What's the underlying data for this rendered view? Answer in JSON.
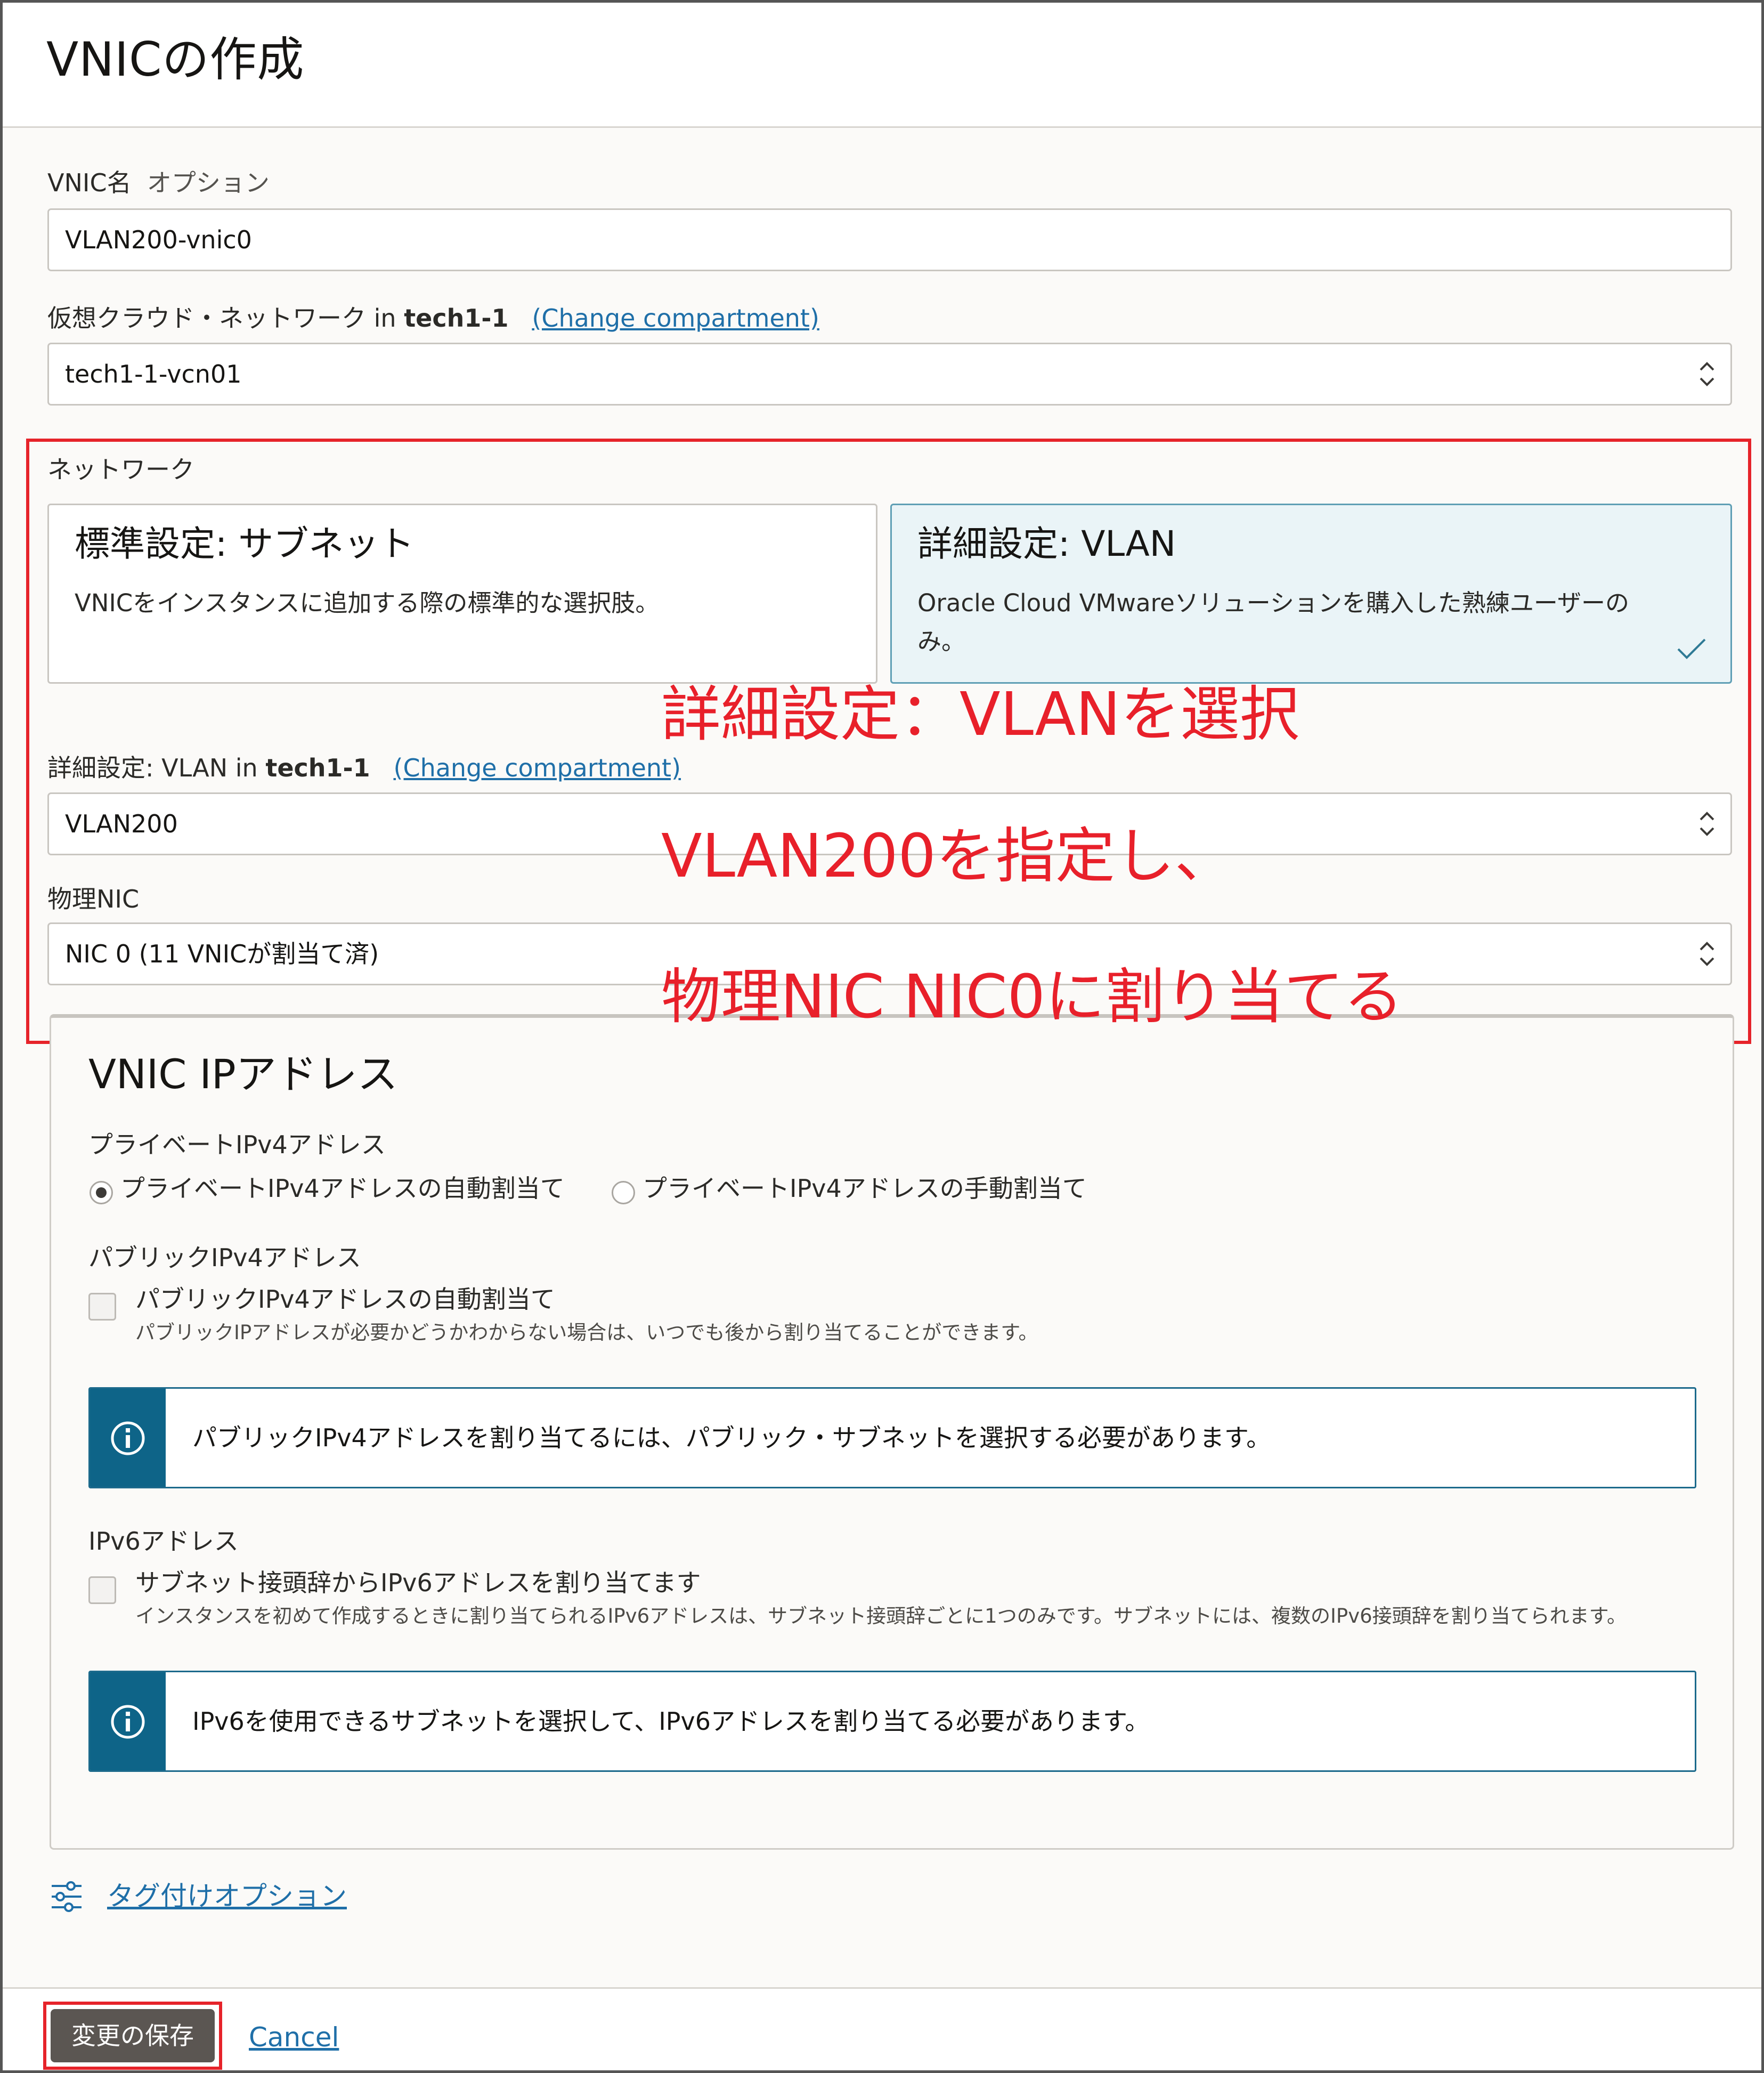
{
  "header": {
    "title": "VNICの作成"
  },
  "form": {
    "vnic_name": {
      "label": "VNIC名",
      "optional": "オプション",
      "value": "VLAN200-vnic0"
    },
    "vcn": {
      "label_prefix": "仮想クラウド・ネットワーク in ",
      "compartment": "tech1-1",
      "change_link": "(Change compartment)",
      "value": "tech1-1-vcn01"
    },
    "network": {
      "label": "ネットワーク",
      "options": [
        {
          "title": "標準設定: サブネット",
          "description": "VNICをインスタンスに追加する際の標準的な選択肢。",
          "selected": false
        },
        {
          "title": "詳細設定: VLAN",
          "description": "Oracle Cloud VMwareソリューションを購入した熟練ユーザーのみ。",
          "selected": true
        }
      ]
    },
    "vlan": {
      "label_prefix": "詳細設定: VLAN in ",
      "compartment": "tech1-1",
      "change_link": "(Change compartment)",
      "value": "VLAN200"
    },
    "physical_nic": {
      "label": "物理NIC",
      "value": "NIC 0 (11 VNICが割当て済)"
    }
  },
  "annotations": {
    "line1": "詳細設定：VLANを選択",
    "line2": "VLAN200を指定し、",
    "line3": "物理NIC NIC0に割り当てる"
  },
  "ip_section": {
    "title": "VNIC IPアドレス",
    "private_ipv4": {
      "label": "プライベートIPv4アドレス",
      "options": [
        {
          "label": "プライベートIPv4アドレスの自動割当て",
          "selected": true
        },
        {
          "label": "プライベートIPv4アドレスの手動割当て",
          "selected": false
        }
      ]
    },
    "public_ipv4": {
      "label": "パブリックIPv4アドレス",
      "checkbox_label": "パブリックIPv4アドレスの自動割当て",
      "checked": false,
      "help": "パブリックIPアドレスが必要かどうかわからない場合は、いつでも後から割り当てることができます。",
      "info": "パブリックIPv4アドレスを割り当てるには、パブリック・サブネットを選択する必要があります。"
    },
    "ipv6": {
      "label": "IPv6アドレス",
      "checkbox_label": "サブネット接頭辞からIPv6アドレスを割り当てます",
      "checked": false,
      "help": "インスタンスを初めて作成するときに割り当てられるIPv6アドレスは、サブネット接頭辞ごとに1つのみです。サブネットには、複数のIPv6接頭辞を割り当てられます。",
      "info": "IPv6を使用できるサブネットを選択して、IPv6アドレスを割り当てる必要があります。"
    }
  },
  "tagging": {
    "link": "タグ付けオプション"
  },
  "footer": {
    "save_label": "変更の保存",
    "cancel_label": "Cancel"
  },
  "colors": {
    "annotation_red": "#e8202a",
    "info_blue": "#0e6488",
    "link_blue": "#1f6fa8",
    "selected_card_bg": "#eaf4f7",
    "save_button_bg": "#5b5652"
  }
}
